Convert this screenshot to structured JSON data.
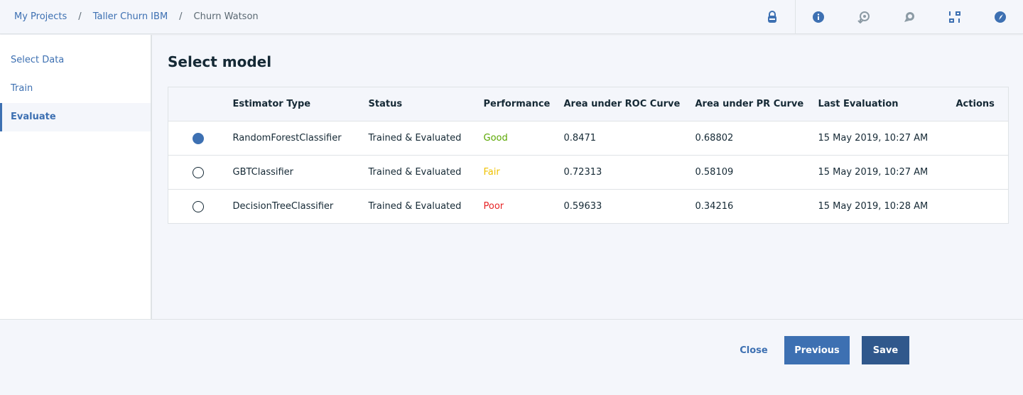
{
  "breadcrumb": {
    "items": [
      "My Projects",
      "Taller Churn IBM"
    ],
    "current": "Churn Watson",
    "separator": "/"
  },
  "header_icons": [
    "lock-icon",
    "info-icon",
    "history-icon",
    "chat-icon",
    "grid-icon",
    "compass-icon"
  ],
  "sidebar": {
    "items": [
      {
        "label": "Select Data"
      },
      {
        "label": "Train"
      },
      {
        "label": "Evaluate",
        "active": true
      }
    ]
  },
  "main": {
    "title": "Select model",
    "columns": [
      "",
      "Estimator Type",
      "Status",
      "Performance",
      "Area under ROC Curve",
      "Area under PR Curve",
      "Last Evaluation",
      "Actions"
    ],
    "rows": [
      {
        "selected": true,
        "estimator": "RandomForestClassifier",
        "status": "Trained & Evaluated",
        "performance": "Good",
        "perf_color": "#5aa700",
        "roc": "0.8471",
        "pr": "0.68802",
        "last": "15 May 2019, 10:27 AM"
      },
      {
        "selected": false,
        "estimator": "GBTClassifier",
        "status": "Trained & Evaluated",
        "performance": "Fair",
        "perf_color": "#efc100",
        "roc": "0.72313",
        "pr": "0.58109",
        "last": "15 May 2019, 10:27 AM"
      },
      {
        "selected": false,
        "estimator": "DecisionTreeClassifier",
        "status": "Trained & Evaluated",
        "performance": "Poor",
        "perf_color": "#e62325",
        "roc": "0.59633",
        "pr": "0.34216",
        "last": "15 May 2019, 10:28 AM"
      }
    ]
  },
  "footer": {
    "close": "Close",
    "previous": "Previous",
    "save": "Save"
  },
  "colors": {
    "accent": "#3d70b2",
    "save": "#30588c"
  }
}
